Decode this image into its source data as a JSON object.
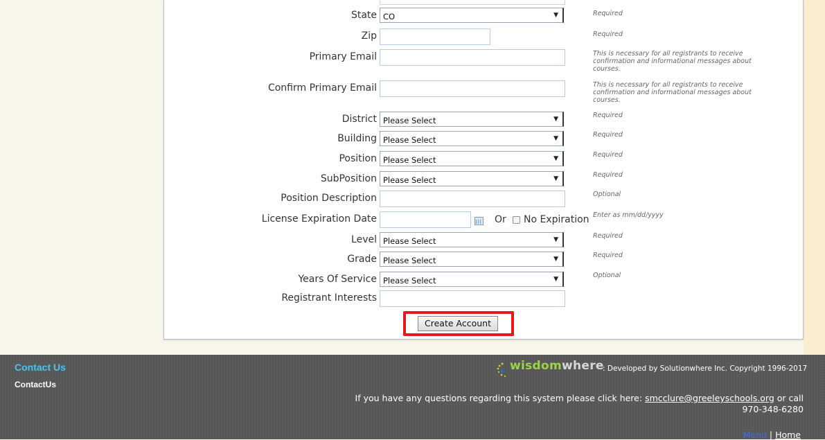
{
  "form": {
    "fields": [
      {
        "label": "State",
        "kind": "select",
        "value": "CO",
        "note": "Required"
      },
      {
        "label": "Zip",
        "kind": "input",
        "value": "",
        "note": "Required"
      },
      {
        "label": "Primary Email",
        "kind": "input",
        "value": "",
        "note": "This is necessary for all registrants to receive confirmation and informational messages about courses."
      },
      {
        "label": "Confirm Primary Email",
        "kind": "input",
        "value": "",
        "note": "This is necessary for all registrants to receive confirmation and informational messages about courses."
      },
      {
        "label": "District",
        "kind": "select",
        "value": "Please Select",
        "note": "Required"
      },
      {
        "label": "Building",
        "kind": "select",
        "value": "Please Select",
        "note": "Required"
      },
      {
        "label": "Position",
        "kind": "select",
        "value": "Please Select",
        "note": "Required"
      },
      {
        "label": "SubPosition",
        "kind": "select",
        "value": "Please Select",
        "note": "Required"
      },
      {
        "label": "Position Description",
        "kind": "input",
        "value": "",
        "note": "Optional"
      },
      {
        "label": "License Expiration Date",
        "kind": "date",
        "value": "",
        "note": "Enter as mm/dd/yyyy",
        "or_text": "Or",
        "checkbox_label": "No Expiration",
        "checkbox_checked": false,
        "icon": "calendar-icon"
      },
      {
        "label": "Level",
        "kind": "select",
        "value": "Please Select",
        "note": "Required"
      },
      {
        "label": "Grade",
        "kind": "select",
        "value": "Please Select",
        "note": "Required"
      },
      {
        "label": "Years Of Service",
        "kind": "select",
        "value": "Please Select",
        "note": "Optional"
      },
      {
        "label": "Registrant Interests",
        "kind": "input",
        "value": "",
        "note": ""
      }
    ],
    "submit_label": "Create Account",
    "highlight_color": "#e3191b"
  },
  "footer": {
    "contact_title": "Contact Us",
    "contact_link": "ContactUs",
    "logo": {
      "part1": "wisdom",
      "part2": "where"
    },
    "developed_text": ": Developed by Solutionwhere Inc. Copyright 1996-2017",
    "question_text": "If you have any questions regarding this system please click here:",
    "email": "smcclure@greeleyschools.org",
    "or_call": "or call",
    "phone": "970-348-6280",
    "menu_link": "Menu",
    "separator": "|",
    "home_link": "Home"
  },
  "colors": {
    "contact_title": "#4dc3f0",
    "footer_bg": "#5a5a5a",
    "menu_link": "#3d6bff"
  }
}
